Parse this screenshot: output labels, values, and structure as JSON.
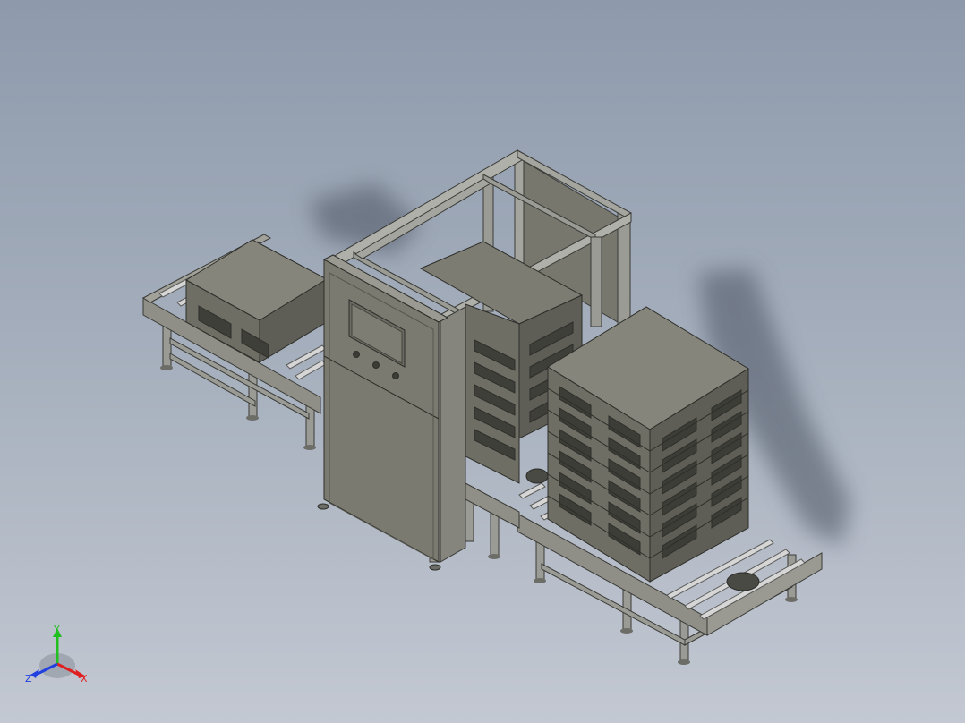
{
  "viewport": {
    "background_top": "#8e9aac",
    "background_bottom": "#c3c8d2",
    "model_fill": "#75756b",
    "model_light": "#8c8c82",
    "model_dark": "#56564e",
    "frame_color": "#9b9b95",
    "roller_color": "#d4d4d4",
    "shadow_color": "#4b5262"
  },
  "triad": {
    "x_label": "X",
    "y_label": "Y",
    "z_label": "Z",
    "x_color": "#e02020",
    "y_color": "#20c020",
    "z_color": "#2040e0"
  }
}
